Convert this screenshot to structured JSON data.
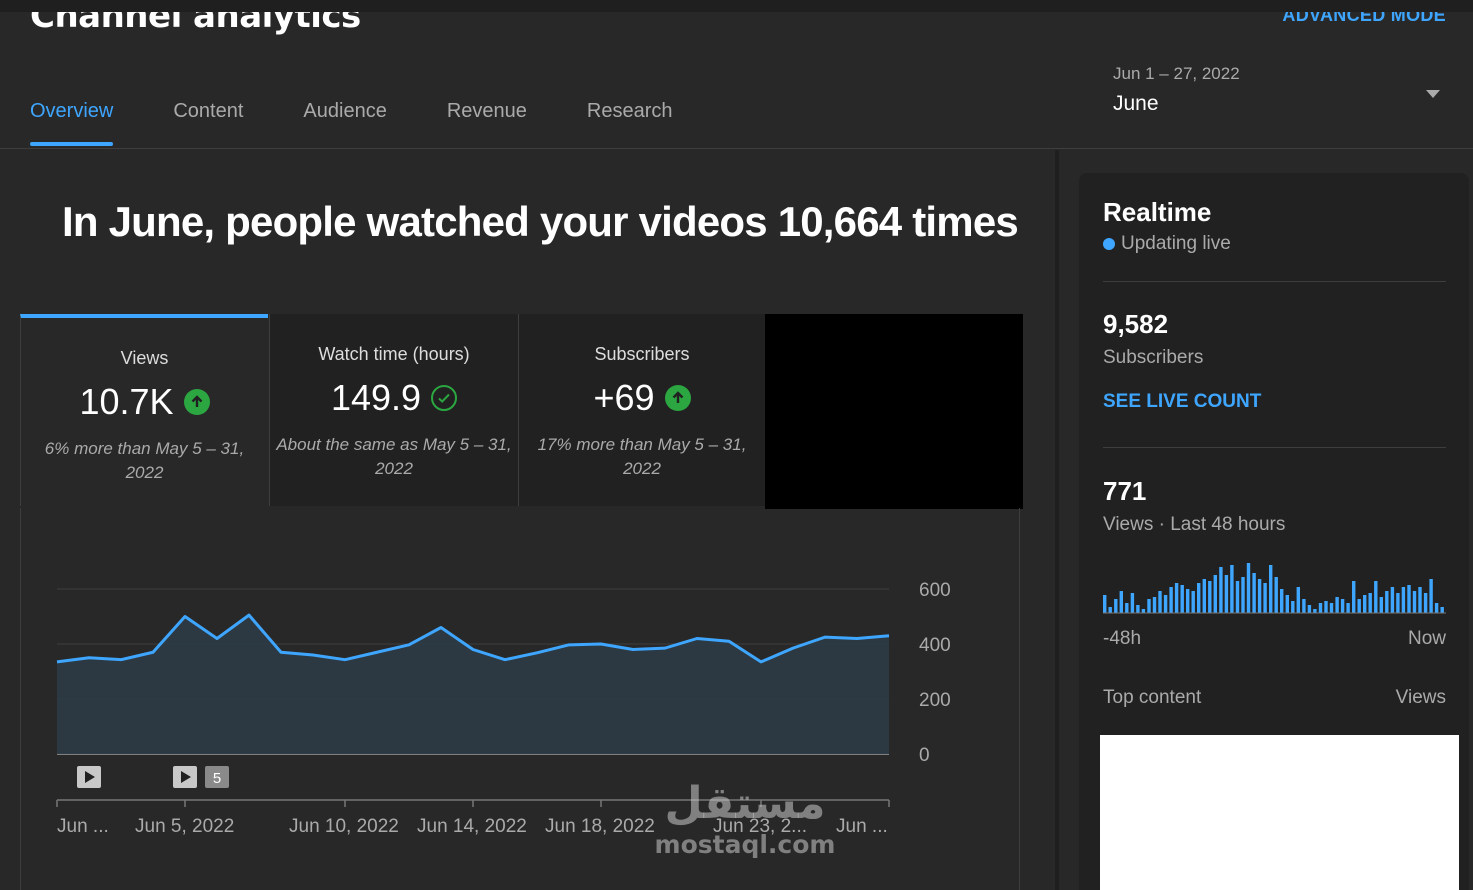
{
  "header": {
    "title": "Channel analytics",
    "advanced_mode": "ADVANCED MODE",
    "tabs": [
      {
        "label": "Overview",
        "active": true
      },
      {
        "label": "Content",
        "active": false
      },
      {
        "label": "Audience",
        "active": false
      },
      {
        "label": "Revenue",
        "active": false
      },
      {
        "label": "Research",
        "active": false
      }
    ],
    "date_range": "Jun 1 – 27, 2022",
    "date_label": "June"
  },
  "main": {
    "headline": "In June, people watched your videos 10,664 times",
    "cards": [
      {
        "label": "Views",
        "value": "10.7K",
        "icon": "arrow-up-icon",
        "comparison": "6% more than May 5 – 31, 2022"
      },
      {
        "label": "Watch time (hours)",
        "value": "149.9",
        "icon": "check-circle-icon",
        "comparison": "About the same as May 5 – 31, 2022"
      },
      {
        "label": "Subscribers",
        "value": "+69",
        "icon": "arrow-up-icon",
        "comparison": "17% more than May 5 – 31, 2022"
      }
    ],
    "video_markers": {
      "marker_count_label": "5"
    }
  },
  "chart_data": {
    "type": "area",
    "title": "",
    "ylim": [
      0,
      600
    ],
    "y_ticks": [
      "600",
      "400",
      "200",
      "0"
    ],
    "x_tick_labels": [
      "Jun ...",
      "Jun 5, 2022",
      "Jun 10, 2022",
      "Jun 14, 2022",
      "Jun 18, 2022",
      "Jun 23, 2...",
      "Jun ..."
    ],
    "values": [
      335,
      350,
      343,
      370,
      500,
      420,
      505,
      370,
      360,
      343,
      370,
      397,
      460,
      380,
      343,
      368,
      397,
      400,
      380,
      385,
      420,
      410,
      335,
      385,
      425,
      420,
      430
    ],
    "color": "#3ea6ff"
  },
  "realtime": {
    "title": "Realtime",
    "status": "Updating live",
    "subscribers_value": "9,582",
    "subscribers_label": "Subscribers",
    "see_live_count": "SEE LIVE COUNT",
    "views_value": "771",
    "views_label": "Views · Last 48 hours",
    "axis_start": "-48h",
    "axis_end": "Now",
    "bars": [
      18,
      6,
      14,
      22,
      10,
      20,
      8,
      4,
      14,
      16,
      22,
      18,
      26,
      30,
      28,
      24,
      22,
      30,
      34,
      32,
      38,
      46,
      38,
      48,
      32,
      36,
      50,
      40,
      34,
      30,
      48,
      36,
      24,
      18,
      12,
      26,
      14,
      8,
      4,
      10,
      12,
      10,
      16,
      14,
      10,
      32,
      14,
      18,
      20,
      32,
      16,
      22,
      26,
      20,
      26,
      28,
      22,
      26,
      20,
      34,
      10,
      6
    ],
    "top_content_label": "Top content",
    "top_views_label": "Views"
  },
  "watermark": {
    "arabic": "مستقل",
    "latin": "mostaql.com"
  }
}
